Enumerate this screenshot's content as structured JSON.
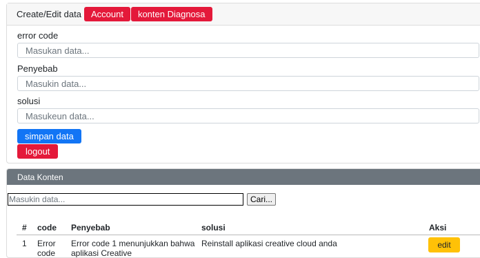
{
  "header": {
    "title": "Create/Edit data",
    "account_label": "Account",
    "konten_label": "konten Diagnosa"
  },
  "form": {
    "error_code_label": "error code",
    "error_code_placeholder": "Masukan data...",
    "penyebab_label": "Penyebab",
    "penyebab_placeholder": "Masukin data...",
    "solusi_label": "solusi",
    "solusi_placeholder": "Masukeun data...",
    "save_label": "simpan data",
    "logout_label": "logout"
  },
  "konten": {
    "title": "Data Konten",
    "search_placeholder": "Masukin data...",
    "search_button": "Cari...",
    "columns": [
      "#",
      "code",
      "Penyebab",
      "solusi",
      "Aksi"
    ],
    "rows": [
      {
        "no": "1",
        "code": "Error code",
        "penyebab": "Error code 1 menunjukkan bahwa aplikasi Creative",
        "solusi": "Reinstall aplikasi creative cloud anda",
        "edit_label": "edit"
      }
    ]
  },
  "colors": {
    "red": "#e4193a",
    "blue": "#1275f5",
    "yellow": "#ffc107",
    "header_gray": "#6c757d"
  }
}
